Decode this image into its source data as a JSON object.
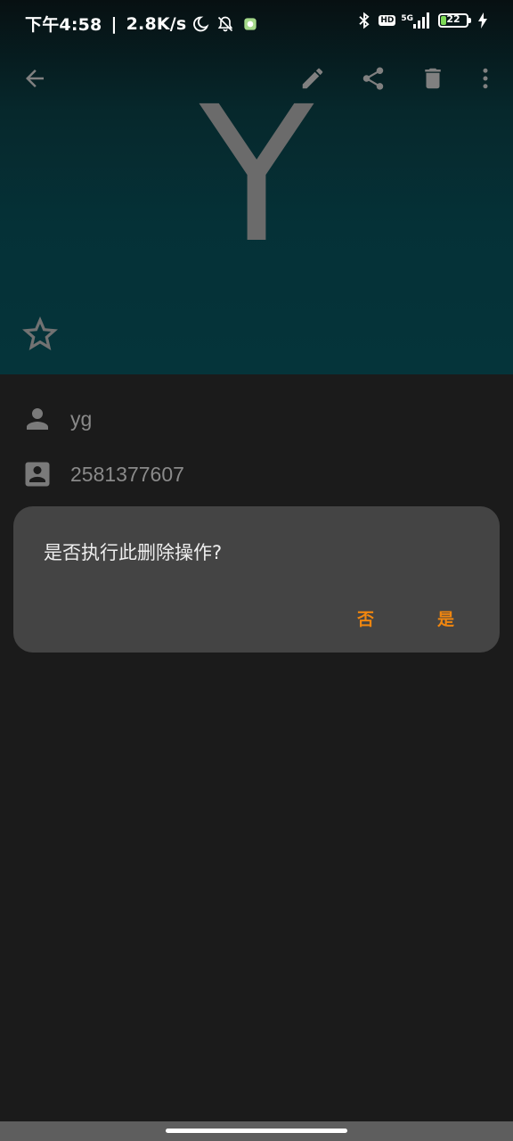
{
  "status_bar": {
    "time": "下午4:58",
    "separator": "|",
    "net_speed": "2.8K/s",
    "network_type": "5G",
    "hd_label": "HD",
    "battery_level": "22",
    "battery_percent": 22,
    "icons": [
      "moon-icon",
      "mute-bell-icon",
      "app-notification-icon",
      "bluetooth-icon",
      "hd-icon",
      "signal-icon",
      "battery-icon",
      "charging-icon"
    ]
  },
  "toolbar": {
    "icons": [
      "back-arrow-icon",
      "edit-pencil-icon",
      "share-icon",
      "delete-trash-icon",
      "more-vert-icon"
    ]
  },
  "contact": {
    "avatar_letter": "Y",
    "name": "yg",
    "number": "2581377607"
  },
  "dialog": {
    "message": "是否执行此删除操作?",
    "negative": "否",
    "positive": "是"
  },
  "colors": {
    "accent": "#f0860f",
    "header_teal": "#05343a",
    "background": "#1b1b1b",
    "dialog_bg": "#444444"
  }
}
